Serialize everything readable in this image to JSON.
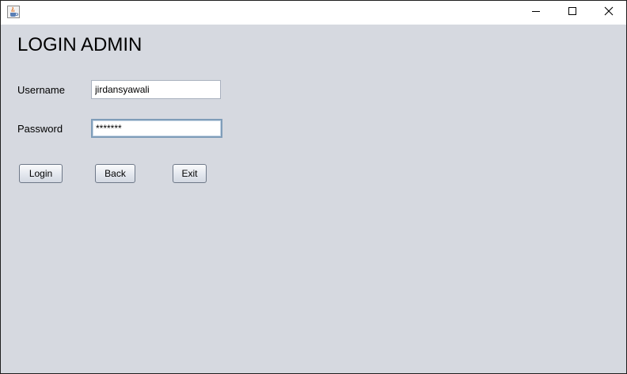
{
  "window": {
    "icon": "java-cup-icon",
    "controls": {
      "minimize_icon": "minimize-icon",
      "maximize_icon": "maximize-icon",
      "close_icon": "close-icon"
    }
  },
  "form": {
    "heading": "LOGIN ADMIN",
    "username": {
      "label": "Username",
      "value": "jirdansyawali"
    },
    "password": {
      "label": "Password",
      "value": "*******"
    }
  },
  "buttons": {
    "login": "Login",
    "back": "Back",
    "exit": "Exit"
  },
  "colors": {
    "background": "#d6d9e0",
    "field_border": "#a9b1be",
    "focus_border": "#7f9db9"
  }
}
